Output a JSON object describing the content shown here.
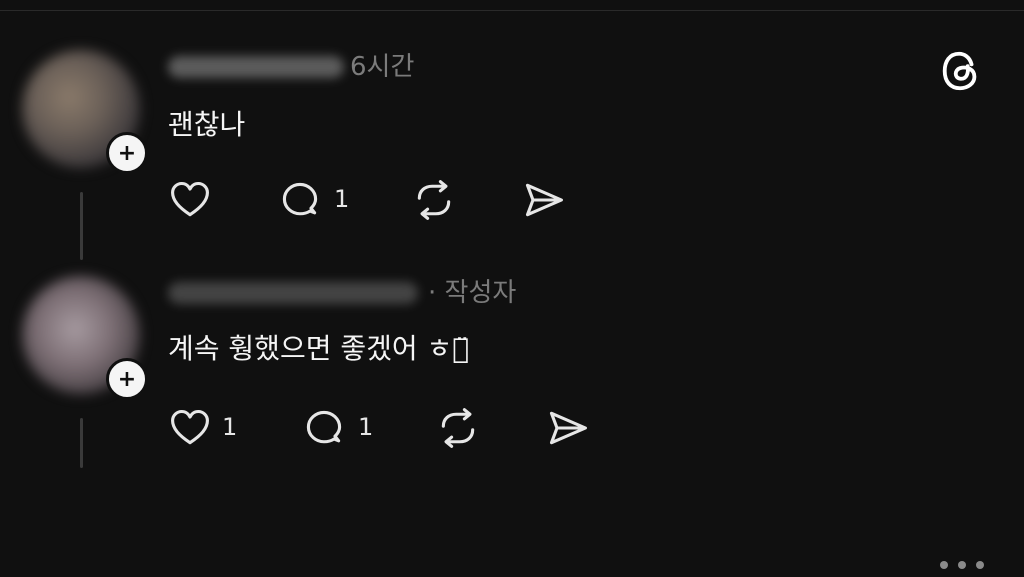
{
  "posts": [
    {
      "time_label": "6시간",
      "text": "괜찮나",
      "like_count": "",
      "reply_count": "1"
    },
    {
      "author_label": "· 작성자",
      "text": "계속 훵했으면 좋겠어 ㅎㅎ̈",
      "like_count": "1",
      "reply_count": "1"
    }
  ],
  "icons": {
    "app_logo": "threads-logo-icon",
    "like": "heart-icon",
    "reply": "comment-icon",
    "repost": "repost-icon",
    "share": "send-icon",
    "more": "more-horizontal-icon",
    "follow": "plus-badge-icon"
  },
  "colors": {
    "background": "#101010",
    "text": "#f5f5f5",
    "muted": "#7b7b7b"
  }
}
